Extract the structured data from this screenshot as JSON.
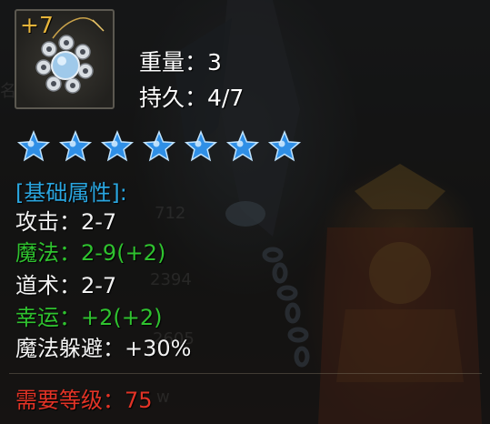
{
  "item": {
    "enhance_level": "+7",
    "icon": "necklace-icon",
    "weight_label": "重量",
    "weight_value": "3",
    "durability_label": "持久",
    "durability_value": "4/7",
    "colon": "："
  },
  "stars": {
    "count": 7,
    "icon": "star-icon",
    "color": "#2f8fe6"
  },
  "attributes": {
    "header": "[基础属性]:",
    "rows": [
      {
        "label": "攻击",
        "value": "2-7",
        "color": "#f2f2f2"
      },
      {
        "label": "魔法",
        "value": "2-9(+2)",
        "color": "#2fc22f"
      },
      {
        "label": "道术",
        "value": "2-7",
        "color": "#f2f2f2"
      },
      {
        "label": "幸运",
        "value": "+2(+2)",
        "color": "#2fc22f"
      },
      {
        "label": "魔法躲避",
        "value": "+30%",
        "color": "#f2f2f2"
      }
    ]
  },
  "requirement": {
    "label": "需要等级",
    "value": "75",
    "color": "#e23326"
  },
  "background_text": [
    "名",
    "712",
    "2394",
    "2605",
    "w"
  ]
}
